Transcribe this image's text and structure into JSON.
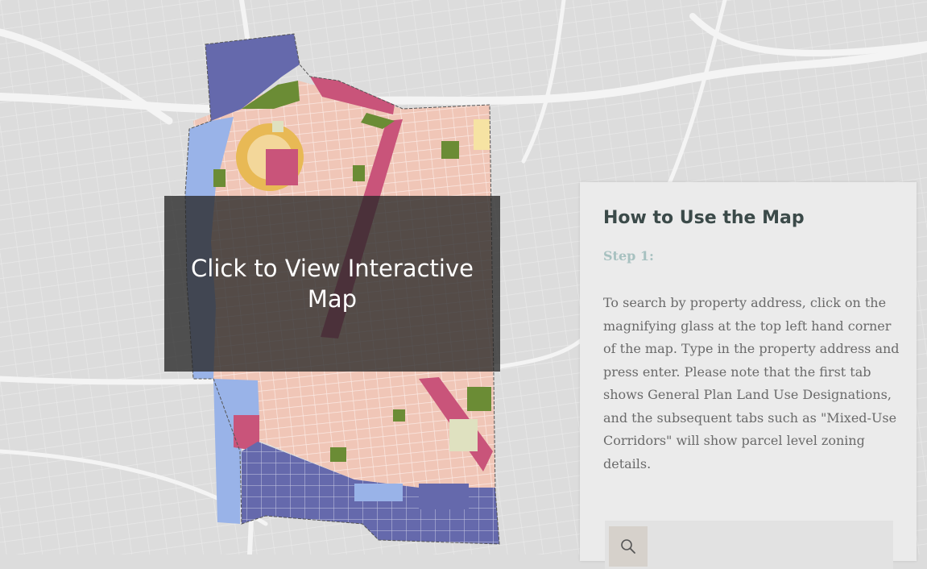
{
  "overlay": {
    "label": "Click to View Interactive Map"
  },
  "panel": {
    "title": "How to Use the Map",
    "step_label": "Step 1:",
    "instructions": "To search by property address, click on the magnifying glass at the top left hand corner of the map. Type in the property address and press enter. Please note that the first tab shows General Plan Land Use Designations, and the subsequent tabs such as \"Mixed-Use Corridors\" will show parcel level zoning details."
  },
  "icons": {
    "search": "search-icon"
  },
  "colors": {
    "basemap": "#dcdcdc",
    "residential": "#f0c6b7",
    "commercial": "#c9547a",
    "industrial": "#6569ac",
    "open_space": "#6b8c35",
    "public_facility": "#99b3e8",
    "mixed_use": "#e8b955",
    "overlay_bg": "#282828",
    "panel_bg": "#ebebeb",
    "panel_title": "#3b4a49",
    "step_color": "#a7c1c0"
  }
}
